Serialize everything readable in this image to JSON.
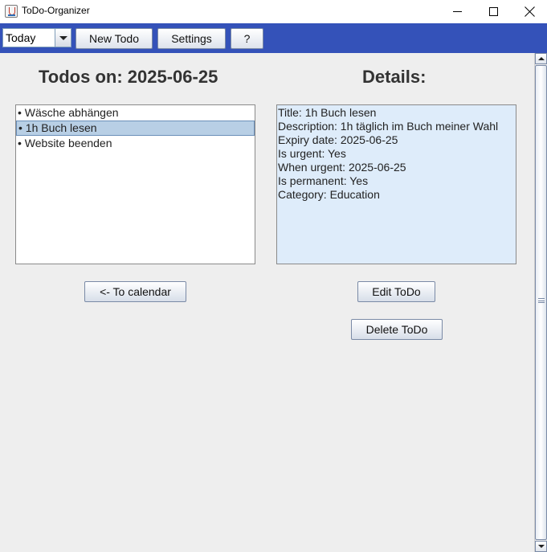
{
  "window": {
    "title": "ToDo-Organizer",
    "icon": "java-coffee-cup-icon"
  },
  "toolbar": {
    "view_select": {
      "value": "Today"
    },
    "new_todo_label": "New Todo",
    "settings_label": "Settings",
    "help_label": "?"
  },
  "colors": {
    "toolbar_bg": "#3452b9",
    "selected_item_bg": "#b8cfe5",
    "details_bg": "#deecfa",
    "content_bg": "#eeeeee"
  },
  "main": {
    "todos_heading": "Todos on: 2025-06-25",
    "details_heading": "Details:",
    "todos": [
      {
        "label": "• Wäsche abhängen",
        "selected": false
      },
      {
        "label": "• 1h Buch lesen",
        "selected": true
      },
      {
        "label": "• Website beenden",
        "selected": false
      }
    ],
    "details": [
      "Title: 1h Buch lesen",
      "Description: 1h täglich im Buch meiner Wahl",
      "Expiry date: 2025-06-25",
      "Is urgent: Yes",
      "When urgent: 2025-06-25",
      "Is permanent: Yes",
      "Category: Education"
    ],
    "to_calendar_label": "<- To calendar",
    "edit_label": "Edit ToDo",
    "delete_label": "Delete ToDo"
  }
}
